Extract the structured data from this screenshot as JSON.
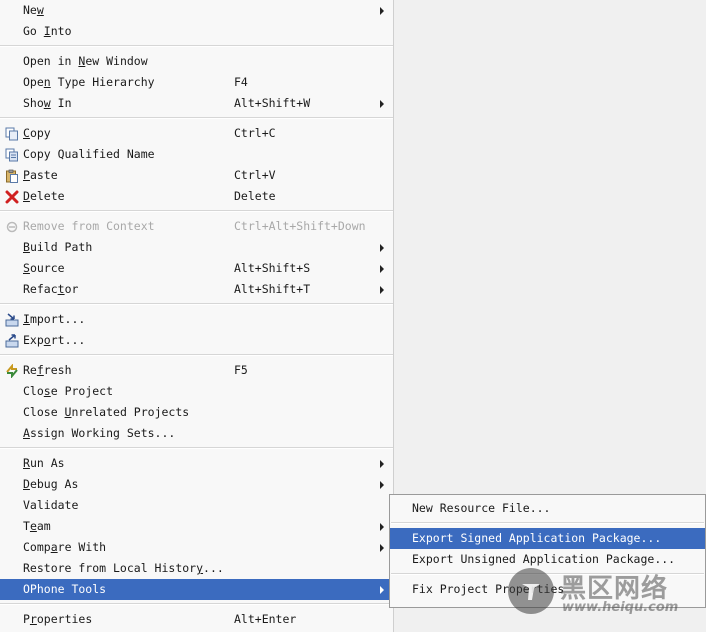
{
  "context_menu": {
    "items": [
      {
        "label": "New",
        "mnemonic": "w",
        "shortcut": "",
        "submenu": true
      },
      {
        "label": "Go Into",
        "mnemonic": "I",
        "shortcut": "",
        "submenu": false
      },
      {
        "label": "Open in New Window",
        "mnemonic": "N",
        "shortcut": "",
        "submenu": false
      },
      {
        "label": "Open Type Hierarchy",
        "mnemonic": "n",
        "shortcut": "F4",
        "submenu": false
      },
      {
        "label": "Show In",
        "mnemonic": "w",
        "shortcut": "Alt+Shift+W",
        "submenu": true
      },
      {
        "label": "Copy",
        "mnemonic": "C",
        "shortcut": "Ctrl+C",
        "submenu": false,
        "icon": "copy-icon"
      },
      {
        "label": "Copy Qualified Name",
        "mnemonic": "",
        "shortcut": "",
        "submenu": false,
        "icon": "copy-qualified-name-icon"
      },
      {
        "label": "Paste",
        "mnemonic": "P",
        "shortcut": "Ctrl+V",
        "submenu": false,
        "icon": "paste-icon"
      },
      {
        "label": "Delete",
        "mnemonic": "D",
        "shortcut": "Delete",
        "submenu": false,
        "icon": "delete-icon"
      },
      {
        "label": "Remove from Context",
        "mnemonic": "",
        "shortcut": "Ctrl+Alt+Shift+Down",
        "submenu": false,
        "icon": "remove-from-context-icon",
        "disabled": true
      },
      {
        "label": "Build Path",
        "mnemonic": "B",
        "shortcut": "",
        "submenu": true
      },
      {
        "label": "Source",
        "mnemonic": "S",
        "shortcut": "Alt+Shift+S",
        "submenu": true
      },
      {
        "label": "Refactor",
        "mnemonic": "t",
        "shortcut": "Alt+Shift+T",
        "submenu": true
      },
      {
        "label": "Import...",
        "mnemonic": "I",
        "shortcut": "",
        "submenu": false,
        "icon": "import-icon"
      },
      {
        "label": "Export...",
        "mnemonic": "o",
        "shortcut": "",
        "submenu": false,
        "icon": "export-icon"
      },
      {
        "label": "Refresh",
        "mnemonic": "f",
        "shortcut": "F5",
        "submenu": false,
        "icon": "refresh-icon"
      },
      {
        "label": "Close Project",
        "mnemonic": "s",
        "shortcut": "",
        "submenu": false
      },
      {
        "label": "Close Unrelated Projects",
        "mnemonic": "U",
        "shortcut": "",
        "submenu": false
      },
      {
        "label": "Assign Working Sets...",
        "mnemonic": "A",
        "shortcut": "",
        "submenu": false
      },
      {
        "label": "Run As",
        "mnemonic": "R",
        "shortcut": "",
        "submenu": true
      },
      {
        "label": "Debug As",
        "mnemonic": "D",
        "shortcut": "",
        "submenu": true
      },
      {
        "label": "Validate",
        "mnemonic": "",
        "shortcut": "",
        "submenu": false
      },
      {
        "label": "Team",
        "mnemonic": "e",
        "shortcut": "",
        "submenu": true
      },
      {
        "label": "Compare With",
        "mnemonic": "a",
        "shortcut": "",
        "submenu": true
      },
      {
        "label": "Restore from Local History...",
        "mnemonic": "y",
        "shortcut": "",
        "submenu": false
      },
      {
        "label": "OPhone Tools",
        "mnemonic": "",
        "shortcut": "",
        "submenu": true,
        "selected": true
      },
      {
        "label": "Properties",
        "mnemonic": "r",
        "shortcut": "Alt+Enter",
        "submenu": false
      }
    ]
  },
  "ophone_submenu": {
    "items": [
      {
        "label": "New Resource File..."
      },
      {
        "label": "Export Signed Application Package...",
        "selected": true
      },
      {
        "label": "Export Unsigned Application Package..."
      },
      {
        "label": "Fix Project Properties"
      }
    ]
  },
  "watermark": {
    "big_text": "黑区网络",
    "small_text": "www.heiqu.com"
  },
  "colors": {
    "selection": "#3b6bbf",
    "menu_background": "#f8f8f8",
    "desktop_background": "#f0f0f0",
    "disabled_text": "#a8a8a8"
  }
}
